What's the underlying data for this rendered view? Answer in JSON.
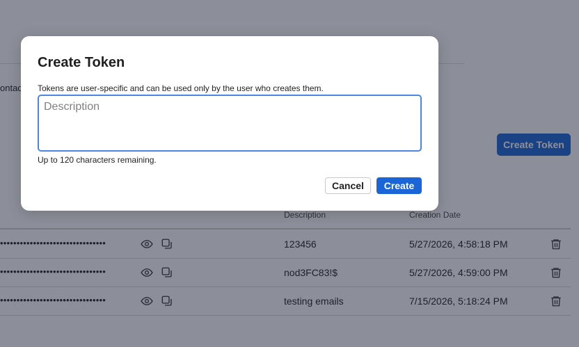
{
  "background": {
    "truncated_text": "ontac",
    "create_token_label": "Create Token",
    "table": {
      "columns": {
        "description": "Description",
        "creation_date": "Creation Date"
      },
      "rows": [
        {
          "masked_token": "••••••••••••••••••••••••••••••••",
          "description": "123456",
          "creation_date": "5/27/2026, 4:58:18 PM"
        },
        {
          "masked_token": "••••••••••••••••••••••••••••••••",
          "description": "nod3FC83!$",
          "creation_date": "5/27/2026, 4:59:00 PM"
        },
        {
          "masked_token": "••••••••••••••••••••••••••••••••",
          "description": "testing emails",
          "creation_date": "7/15/2026, 5:18:24 PM"
        }
      ]
    }
  },
  "modal": {
    "title": "Create Token",
    "help_text": "Tokens are user-specific and can be used only by the user who creates them.",
    "description_input": {
      "value": "",
      "placeholder": "Description"
    },
    "char_count_text": "Up to 120 characters remaining.",
    "cancel_label": "Cancel",
    "create_label": "Create"
  },
  "colors": {
    "primary": "#1a66d9",
    "input_focus_border": "#4a86e4",
    "overlay": "rgba(25, 32, 52, 0.50)"
  },
  "icons": {
    "row_actions": [
      "eye-icon",
      "copy-icon",
      "trash-icon"
    ]
  }
}
